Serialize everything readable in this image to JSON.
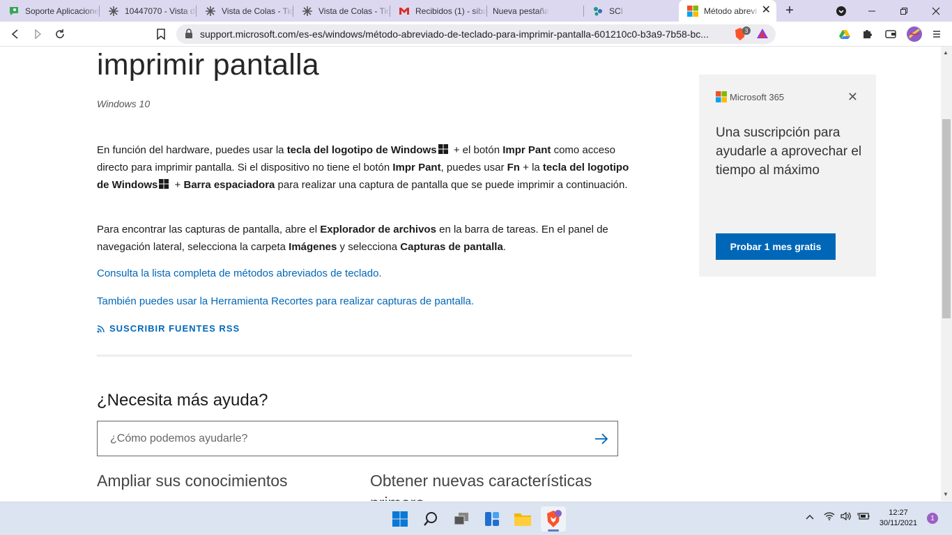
{
  "tabs": [
    {
      "label": "Soporte Aplicaciones",
      "icon": "chat-icon"
    },
    {
      "label": "10447070 - Vista de",
      "icon": "asterisk-icon"
    },
    {
      "label": "Vista de Colas - Tic",
      "icon": "asterisk-icon"
    },
    {
      "label": "Vista de Colas - Tic",
      "icon": "asterisk-icon"
    },
    {
      "label": "Recibidos (1) - siba",
      "icon": "gmail-icon"
    },
    {
      "label": "Nueva pestaña",
      "icon": "none"
    },
    {
      "label": "SCI",
      "icon": "sci-icon"
    },
    {
      "label": "Método abrevi",
      "icon": "microsoft-icon"
    }
  ],
  "address_bar": {
    "url": "support.microsoft.com/es-es/windows/método-abreviado-de-teclado-para-imprimir-pantalla-601210c0-b3a9-7b58-bc..."
  },
  "extensions": {
    "brave_badge": "3"
  },
  "article": {
    "title": "imprimir pantalla",
    "os": "Windows 10",
    "p1": {
      "a": "En función del hardware, puedes usar la ",
      "b1": "tecla del logotipo de Windows",
      "c": " + el botón ",
      "b2": "Impr Pant",
      "d": " como acceso directo para imprimir pantalla. Si el dispositivo no tiene el botón ",
      "b3": "Impr Pant",
      "e": ", puedes usar ",
      "b4": "Fn",
      "f": " + la ",
      "b5": "tecla del logotipo de Windows",
      "g": " + ",
      "b6": "Barra espaciadora",
      "h": " para realizar una captura de pantalla que se puede imprimir a continuación."
    },
    "p2": {
      "a": "Para encontrar las capturas de pantalla, abre el ",
      "b1": "Explorador de archivos",
      "c": " en la barra de tareas. En el panel de navegación lateral, selecciona la carpeta ",
      "b2": "Imágenes",
      "d": " y selecciona ",
      "b3": "Capturas de pantalla",
      "e": "."
    },
    "link1": "Consulta la lista completa de métodos abreviados de teclado.",
    "link2": "También puedes usar la Herramienta Recortes para realizar capturas de pantalla.",
    "rss": "SUSCRIBIR FUENTES RSS"
  },
  "help": {
    "heading": "¿Necesita más ayuda?",
    "search_placeholder": "¿Cómo podemos ayudarle?",
    "col1": "Ampliar sus conocimientos",
    "col2": "Obtener nuevas características primero"
  },
  "promo": {
    "brand": "Microsoft 365",
    "text": "Una suscripción para ayudarle a aprovechar el tiempo al máximo",
    "button": "Probar 1 mes gratis"
  },
  "taskbar": {
    "time": "12:27",
    "date": "30/11/2021",
    "notifications": "1"
  },
  "colors": {
    "accent": "#0067b8",
    "tabstrip": "#dcd8f0",
    "taskbar": "#dbe4f0"
  }
}
